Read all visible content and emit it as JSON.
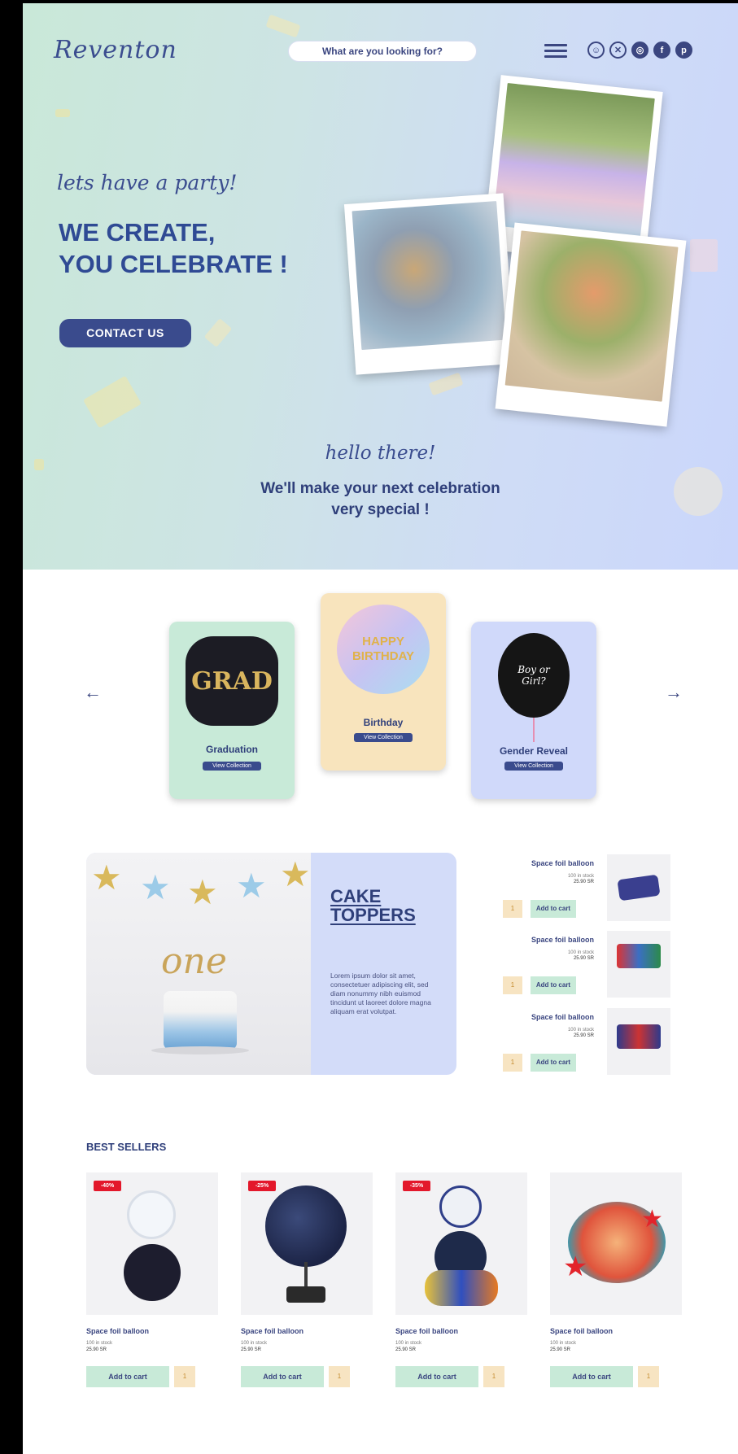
{
  "header": {
    "logo": "Reventon",
    "search_placeholder": "What are you looking for?",
    "icons": [
      "user-icon",
      "close-circle-icon",
      "instagram-icon",
      "facebook-icon",
      "pinterest-icon"
    ]
  },
  "hero": {
    "tagline": "lets have a party!",
    "headline_line1": "WE CREATE,",
    "headline_line2": "YOU CELEBRATE !",
    "cta": "CONTACT US",
    "hello": "hello there!",
    "sub_line1": "We'll make your next celebration",
    "sub_line2": "very special !"
  },
  "categories": {
    "items": [
      {
        "label": "Graduation",
        "button": "View Collection",
        "image_text": "GRAD",
        "bg": "#c8ead8"
      },
      {
        "label": "Birthday",
        "button": "View Collection",
        "image_text": "HAPPY BIRTHDAY",
        "bg": "#f8e4bd"
      },
      {
        "label": "Gender Reveal",
        "button": "View Collection",
        "image_text": "Boy or Girl?",
        "bg": "#d0d9fa"
      }
    ],
    "prev": "←",
    "next": "→"
  },
  "cake_toppers": {
    "title_line1": "CAKE",
    "title_line2": "TOPPERS",
    "image_text": "one",
    "body": "Lorem ipsum dolor sit amet, consectetuer adipiscing elit, sed diam nonummy nibh euismod tincidunt ut laoreet dolore magna aliquam erat volutpat."
  },
  "mini_products": [
    {
      "name": "Space foil balloon",
      "stock": "100 in stock",
      "price": "25.90 SR",
      "add": "Add to cart",
      "qty": "1"
    },
    {
      "name": "Space foil balloon",
      "stock": "100 in stock",
      "price": "25.90 SR",
      "add": "Add to cart",
      "qty": "1"
    },
    {
      "name": "Space foil balloon",
      "stock": "100 in stock",
      "price": "25.90 SR",
      "add": "Add to cart",
      "qty": "1"
    }
  ],
  "best_sellers": {
    "title": "BEST SELLERS",
    "products": [
      {
        "badge": "-40%",
        "name": "Space foil balloon",
        "stock": "100 in stock",
        "price": "25.90 SR",
        "add": "Add to cart",
        "qty": "1"
      },
      {
        "badge": "-25%",
        "name": "Space foil balloon",
        "stock": "100 in stock",
        "price": "25.90 SR",
        "add": "Add to cart",
        "qty": "1"
      },
      {
        "badge": "-35%",
        "name": "Space foil balloon",
        "stock": "100 in stock",
        "price": "25.90 SR",
        "add": "Add to cart",
        "qty": "1"
      },
      {
        "badge": "",
        "name": "Space foil balloon",
        "stock": "100 in stock",
        "price": "25.90 SR",
        "add": "Add to cart",
        "qty": "1"
      }
    ]
  },
  "colors": {
    "navy": "#3a4b8d",
    "mint": "#c8ead8",
    "peach": "#f8e4bd",
    "lavender": "#d0d9fa",
    "sale_red": "#e3182b"
  }
}
